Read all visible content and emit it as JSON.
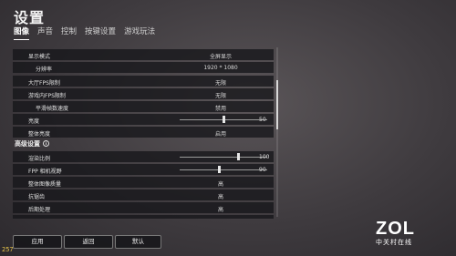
{
  "header": {
    "title": "设置"
  },
  "tabs": [
    {
      "label": "图像",
      "active": true
    },
    {
      "label": "声音",
      "active": false
    },
    {
      "label": "控制",
      "active": false
    },
    {
      "label": "按键设置",
      "active": false
    },
    {
      "label": "游戏玩法",
      "active": false
    }
  ],
  "settings": {
    "display_mode": {
      "label": "显示模式",
      "value": "全屏显示"
    },
    "resolution": {
      "label": "分辨率",
      "value": "1920 * 1080"
    },
    "lobby_fps": {
      "label": "大厅FPS限制",
      "value": "无限"
    },
    "ingame_fps": {
      "label": "游戏内FPS限制",
      "value": "无限"
    },
    "smooth_frame": {
      "label": "平滑帧数速度",
      "value": "禁用"
    },
    "brightness": {
      "label": "亮度",
      "value": "50",
      "level": 0.5
    },
    "overall_brightness": {
      "label": "整体亮度",
      "value": "启用"
    }
  },
  "advanced": {
    "heading": "高级设置",
    "render_scale": {
      "label": "渲染比例",
      "value": "100",
      "level": 0.67
    },
    "fpp_fov": {
      "label": "FPP 相机视野",
      "value": "90",
      "level": 0.45
    },
    "overall_quality": {
      "label": "整体图像质量",
      "value": "高"
    },
    "anti_aliasing": {
      "label": "抗锯齿",
      "value": "高"
    },
    "post_processing": {
      "label": "后期处理",
      "value": "高"
    }
  },
  "footer": {
    "apply": "应用",
    "back": "返回",
    "default": "默认"
  },
  "fps_counter": "257",
  "watermark": {
    "logo": "ZOL",
    "sub": "中关村在线"
  }
}
